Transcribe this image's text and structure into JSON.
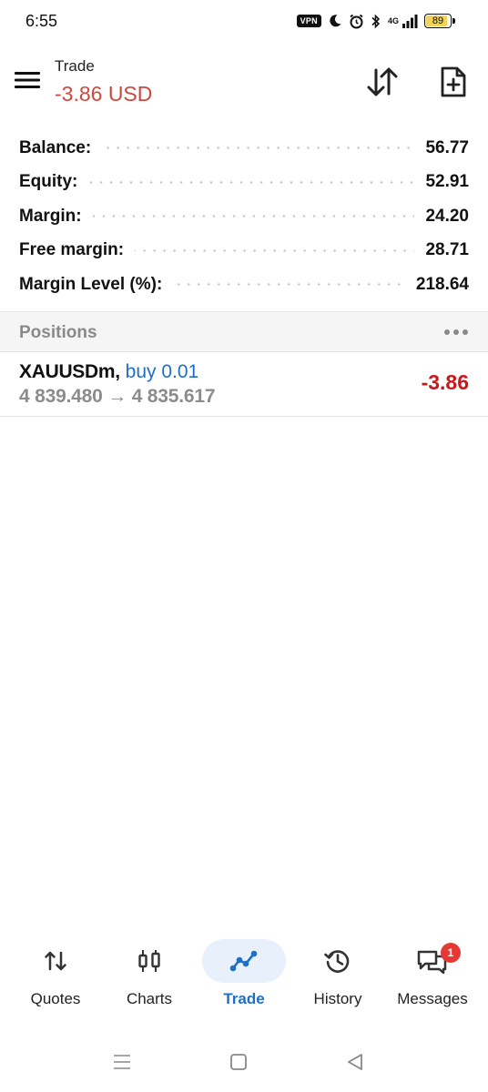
{
  "status_bar": {
    "time": "6:55",
    "vpn_label": "VPN",
    "network_label": "4G",
    "battery": "89",
    "battery_level": 0.89
  },
  "header": {
    "title": "Trade",
    "balance": "-3.86 USD",
    "balance_color": "#d0473e"
  },
  "summary": {
    "rows": [
      {
        "label": "Balance:",
        "value": "56.77"
      },
      {
        "label": "Equity:",
        "value": "52.91"
      },
      {
        "label": "Margin:",
        "value": "24.20"
      },
      {
        "label": "Free margin:",
        "value": "28.71"
      },
      {
        "label": "Margin Level (%):",
        "value": "218.64"
      }
    ]
  },
  "positions": {
    "title": "Positions",
    "items": [
      {
        "symbol": "XAUUSDm,",
        "side": "buy 0.01",
        "prices": "4 839.480 → 4 835.617",
        "profit": "-3.86"
      }
    ]
  },
  "bottom_nav": {
    "items": [
      {
        "label": "Quotes",
        "icon": "quotes-icon"
      },
      {
        "label": "Charts",
        "icon": "charts-icon"
      },
      {
        "label": "Trade",
        "icon": "trade-icon",
        "active": true
      },
      {
        "label": "History",
        "icon": "history-icon"
      },
      {
        "label": "Messages",
        "icon": "messages-icon",
        "badge": "1"
      }
    ]
  },
  "colors": {
    "accent": "#1e6fc8",
    "loss": "#c8181e",
    "active_nav_bg": "#e8f1fb",
    "badge": "#e53935"
  }
}
